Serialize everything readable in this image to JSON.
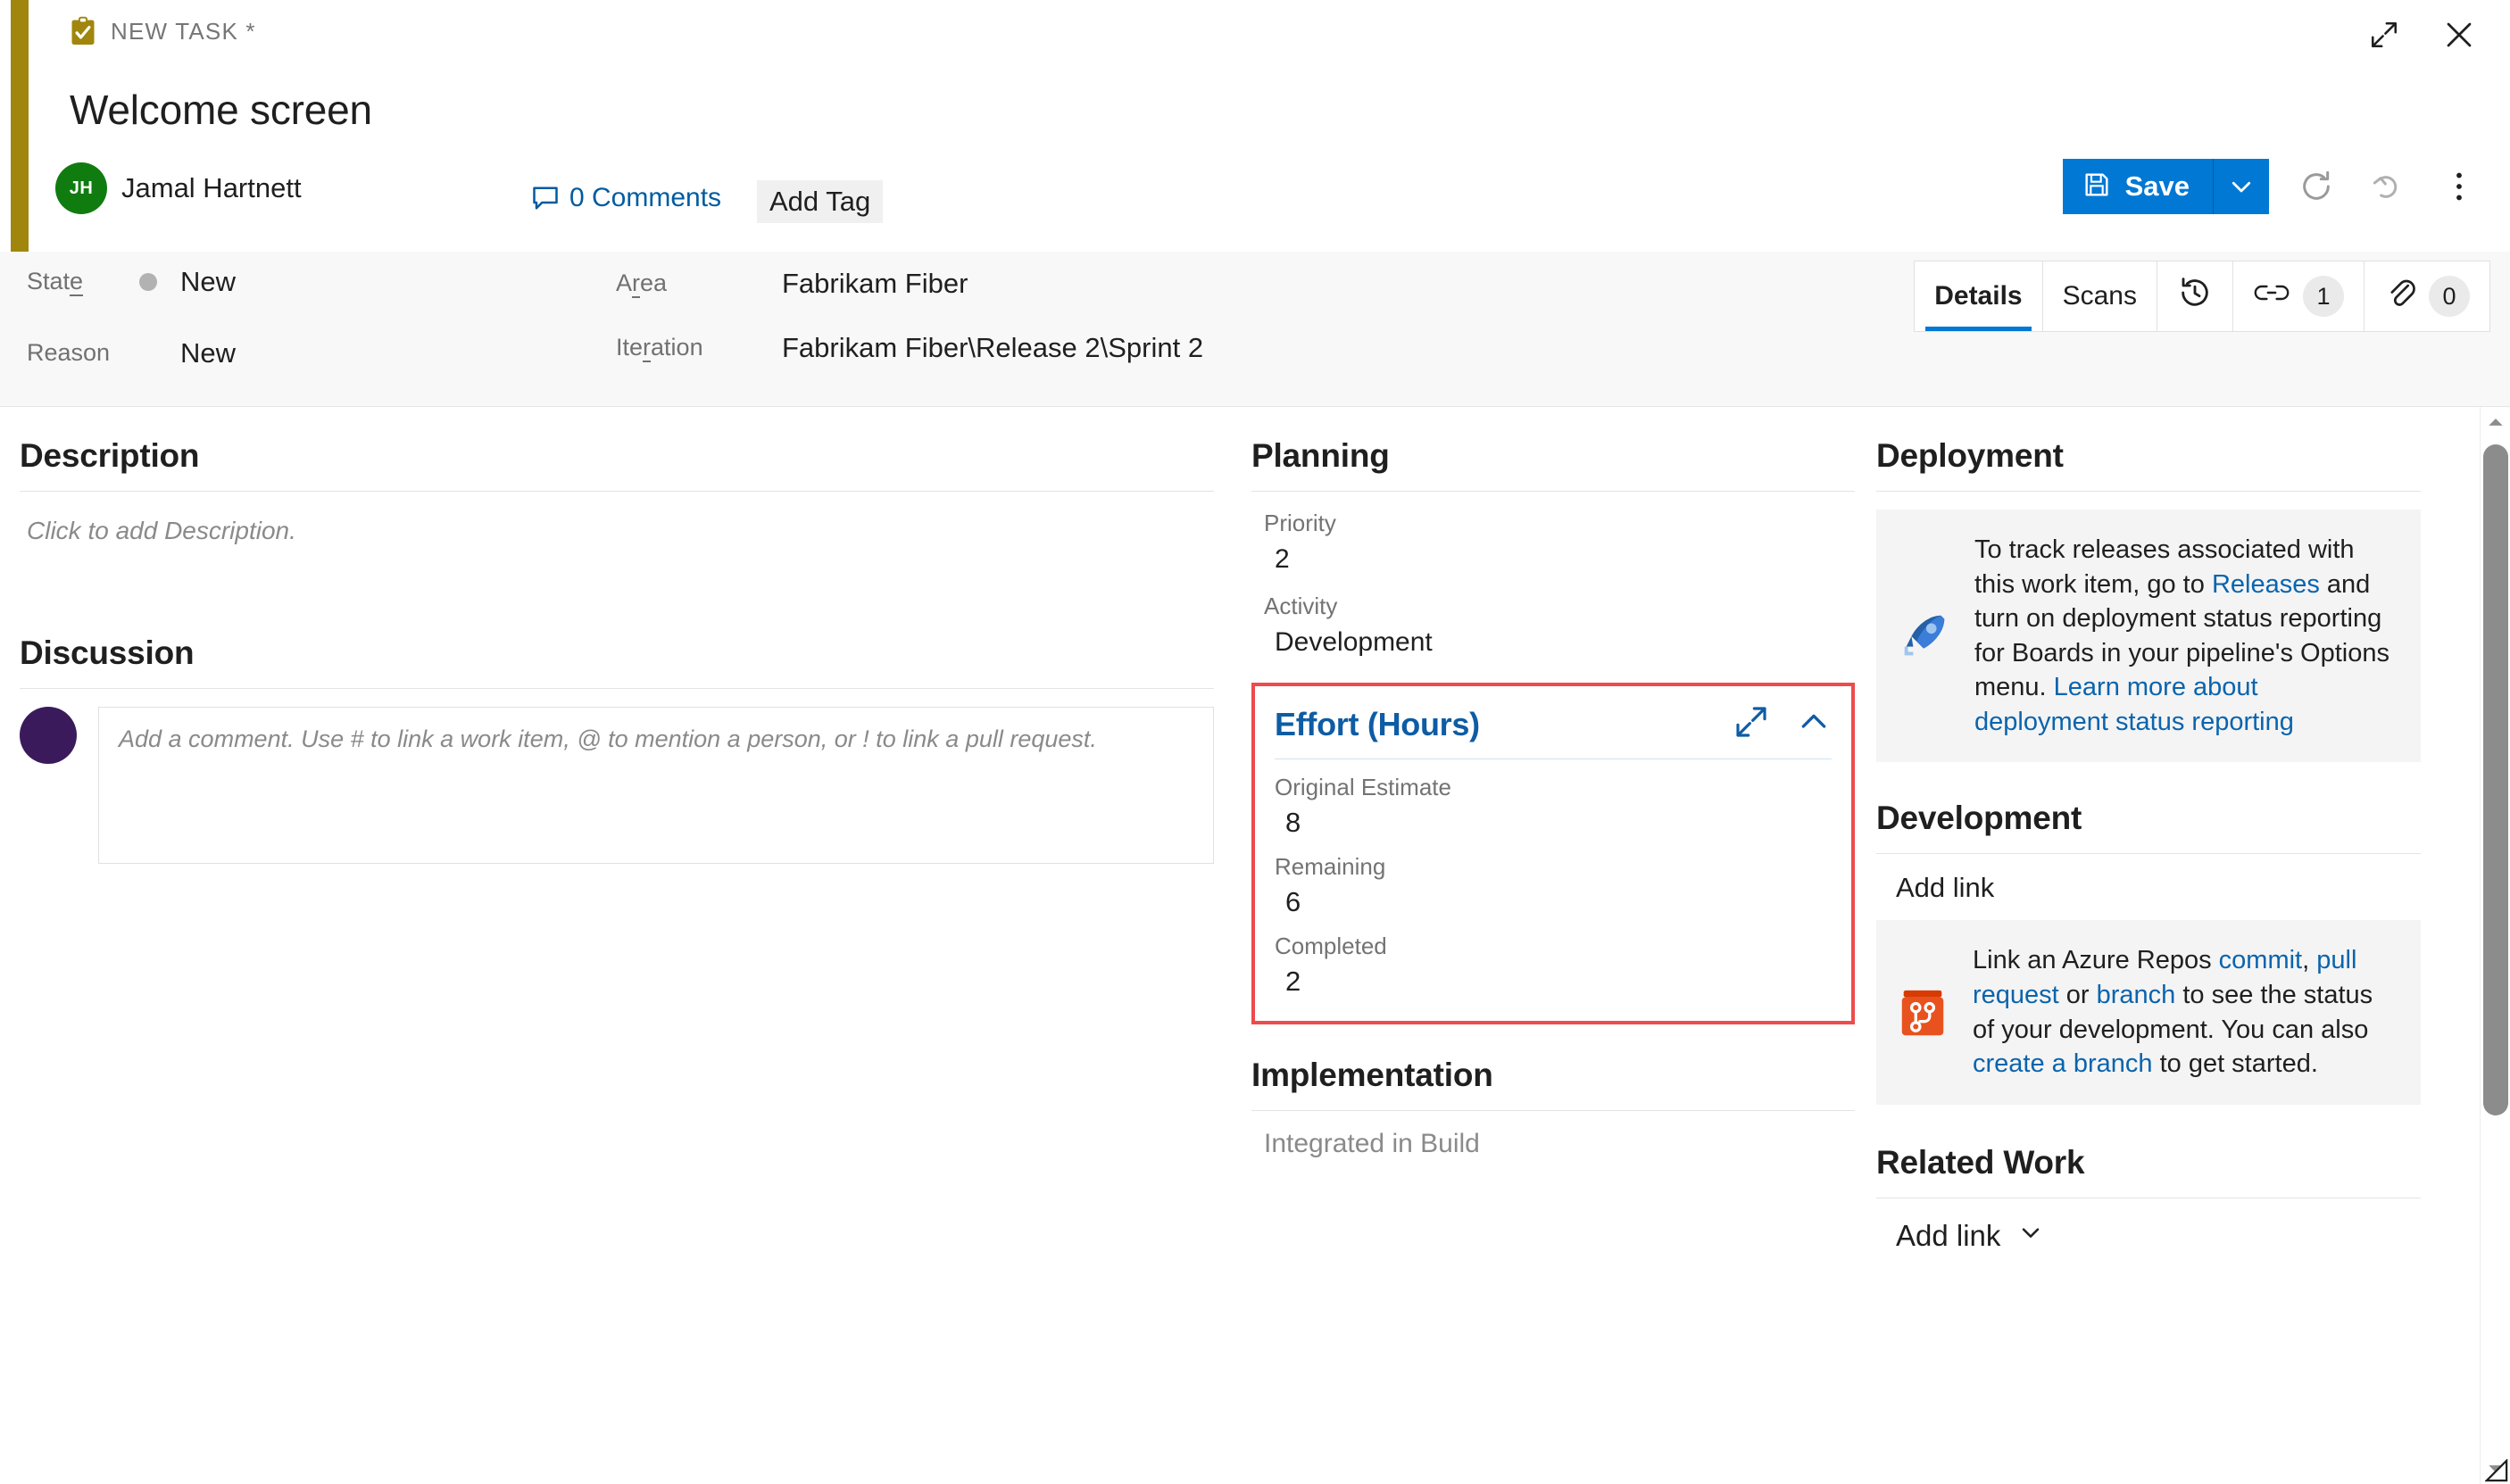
{
  "header": {
    "work_item_type": "NEW TASK *",
    "type_icon": "clipboard-check-icon",
    "title": "Welcome screen",
    "assignee_initials": "JH",
    "assignee_name": "Jamal Hartnett",
    "assignee_avatar_color": "#107c10",
    "comments_label": "0 Comments",
    "add_tag_label": "Add Tag",
    "accent_color": "#a1860d",
    "expand_icon": "expand-diagonal-icon",
    "close_icon": "close-icon"
  },
  "toolbar": {
    "save_label": "Save",
    "save_icon": "save-disk-icon",
    "save_caret_icon": "chevron-down-icon",
    "refresh_icon": "refresh-icon",
    "undo_icon": "undo-icon",
    "more_icon": "more-vertical-icon",
    "accent_color": "#0078d4"
  },
  "fields": {
    "state": {
      "label": "State",
      "value": "New",
      "dot_color": "#b2b2b2"
    },
    "reason": {
      "label": "Reason",
      "value": "New"
    },
    "area": {
      "label": "Area",
      "value": "Fabrikam Fiber"
    },
    "iteration": {
      "label": "Iteration",
      "value": "Fabrikam Fiber\\Release 2\\Sprint 2"
    }
  },
  "tabs": [
    {
      "label": "Details",
      "active": true
    },
    {
      "label": "Scans",
      "active": false
    },
    {
      "icon": "history-icon",
      "label": "",
      "active": false
    },
    {
      "icon": "link-icon",
      "badge": "1",
      "active": false
    },
    {
      "icon": "attachment-icon",
      "badge": "0",
      "active": false
    }
  ],
  "description": {
    "title": "Description",
    "placeholder": "Click to add Description."
  },
  "discussion": {
    "title": "Discussion",
    "comment_placeholder": "Add a comment. Use # to link a work item, @ to mention a person, or ! to link a pull request.",
    "avatar_color": "#3b1a5c"
  },
  "planning": {
    "title": "Planning",
    "priority_label": "Priority",
    "priority_value": "2",
    "activity_label": "Activity",
    "activity_value": "Development"
  },
  "effort": {
    "title": "Effort (Hours)",
    "highlight_color": "#ee4b4b",
    "title_color": "#0e5ca4",
    "expand_icon": "expand-diagonal-icon",
    "collapse_icon": "chevron-up-icon",
    "original_estimate_label": "Original Estimate",
    "original_estimate_value": "8",
    "remaining_label": "Remaining",
    "remaining_value": "6",
    "completed_label": "Completed",
    "completed_value": "2"
  },
  "implementation": {
    "title": "Implementation",
    "integrated_in_build_label": "Integrated in Build"
  },
  "deployment": {
    "title": "Deployment",
    "icon": "azure-pipelines-rocket-icon",
    "text_part1": "To track releases associated with this work item, go to ",
    "link1": "Releases",
    "text_part2": " and turn on deployment status reporting for Boards in your pipeline's Options menu. ",
    "link2": "Learn more about deployment status reporting"
  },
  "development": {
    "title": "Development",
    "add_link_label": "Add link",
    "icon": "azure-repos-icon",
    "text_part1": "Link an Azure Repos ",
    "link_commit": "commit",
    "text_part2": ", ",
    "link_pull_request": "pull request",
    "text_part3": " or ",
    "link_branch": "branch",
    "text_part4": " to see the status of your development. You can also ",
    "link_create_branch": "create a branch",
    "text_part5": " to get started."
  },
  "related_work": {
    "title": "Related Work",
    "add_link_label": "Add link",
    "caret_icon": "chevron-down-icon"
  }
}
